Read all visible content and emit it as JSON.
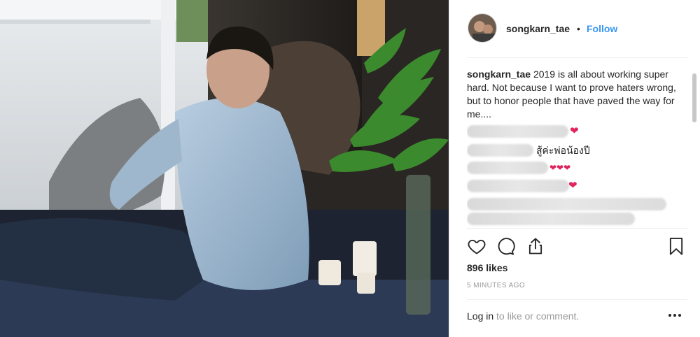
{
  "post": {
    "username": "songkarn_tae",
    "separator": "•",
    "follow_label": "Follow",
    "caption_user": "songkarn_tae",
    "caption_text": "2019 is all about working super hard. Not because I want to prove haters wrong, but to honor people that have paved the way for me....",
    "comment_thai": "สู้ค่ะพ่อน้องปี",
    "heart": "❤",
    "hearts_triple": "❤❤❤",
    "likes": "896 likes",
    "timestamp": "5 MINUTES AGO",
    "login_link": "Log in",
    "login_rest": " to like or comment."
  },
  "icons": {
    "like": "heart-outline-icon",
    "comment": "comment-bubble-icon",
    "share": "share-upload-icon",
    "save": "bookmark-icon",
    "more": "more-dots-icon"
  },
  "colors": {
    "link_blue": "#3897f0",
    "heart_red": "#e0245e",
    "muted_gray": "#999999",
    "text_dark": "#262626"
  }
}
